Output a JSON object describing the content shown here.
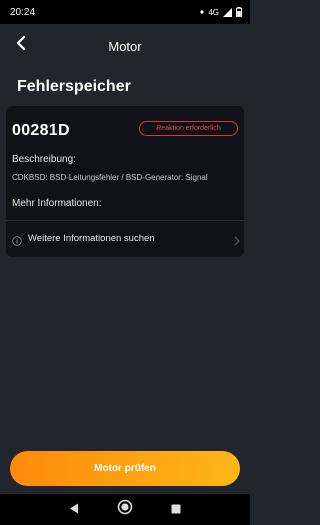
{
  "status_bar": {
    "time": "20:24",
    "network": "4G"
  },
  "header": {
    "title": "Motor"
  },
  "section": {
    "title": "Fehlerspeicher"
  },
  "error_card": {
    "code": "00281D",
    "status_badge": "Reaktion erforderlich",
    "description_label": "Beschreibung:",
    "description_value": "CDKBSD: BSD-Leitungsfehler / BSD-Generator: Signal",
    "more_info_label": "Mehr Informationen:",
    "search_link_label": "Weitere Informationen suchen"
  },
  "actions": {
    "primary_label": "Motor prüfen"
  },
  "colors": {
    "background": "#23252c",
    "card": "#111217",
    "badge": "#d43a3a",
    "button_start": "#ff8a0c",
    "button_end": "#fdb716"
  },
  "icons": [
    "back-arrow-icon",
    "info-icon",
    "chevron-right-icon",
    "nav-back-icon",
    "nav-home-icon",
    "nav-recents-icon",
    "signal-icon",
    "battery-icon",
    "notification-dot-icon"
  ]
}
